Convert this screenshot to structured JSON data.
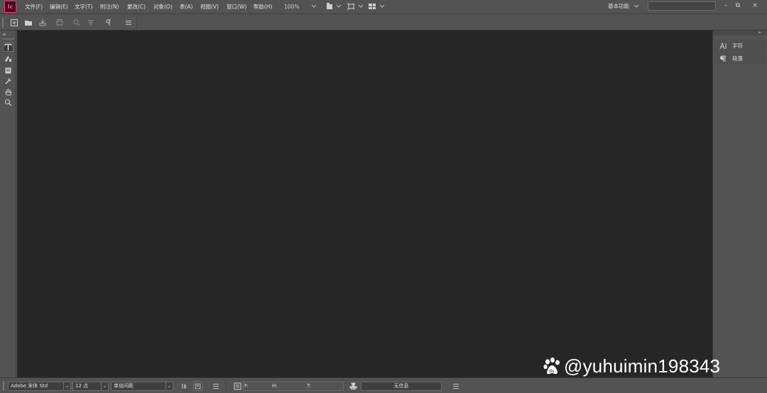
{
  "app": {
    "logo_text": "Ic",
    "brand_color": "#ff3366"
  },
  "menu": {
    "items": [
      "文件(F)",
      "编辑(E)",
      "文字(T)",
      "附注(N)",
      "更改(C)",
      "对象(O)",
      "表(A)",
      "视图(V)",
      "窗口(W)",
      "帮助(H)"
    ],
    "zoom": "100%"
  },
  "workspace": {
    "label": "基本功能"
  },
  "search": {
    "value": ""
  },
  "window_controls": {
    "minimize": "–",
    "restore": "⧉",
    "close": "×"
  },
  "right_panel": {
    "tabs": [
      {
        "label": "字符",
        "icon": "character-icon"
      },
      {
        "label": "段落",
        "icon": "paragraph-icon"
      }
    ]
  },
  "bottom_bar": {
    "font_family": "Adobe 宋体 Std",
    "font_size": "12 点",
    "line_spacing": "单倍间距",
    "f_label": "F:",
    "h_label": "H:",
    "t_label": "T:",
    "status": "无信息"
  },
  "watermark": {
    "text": "@yuhuimin198343"
  },
  "colors": {
    "document_bg": "#262626",
    "chrome_bg": "#535353"
  }
}
